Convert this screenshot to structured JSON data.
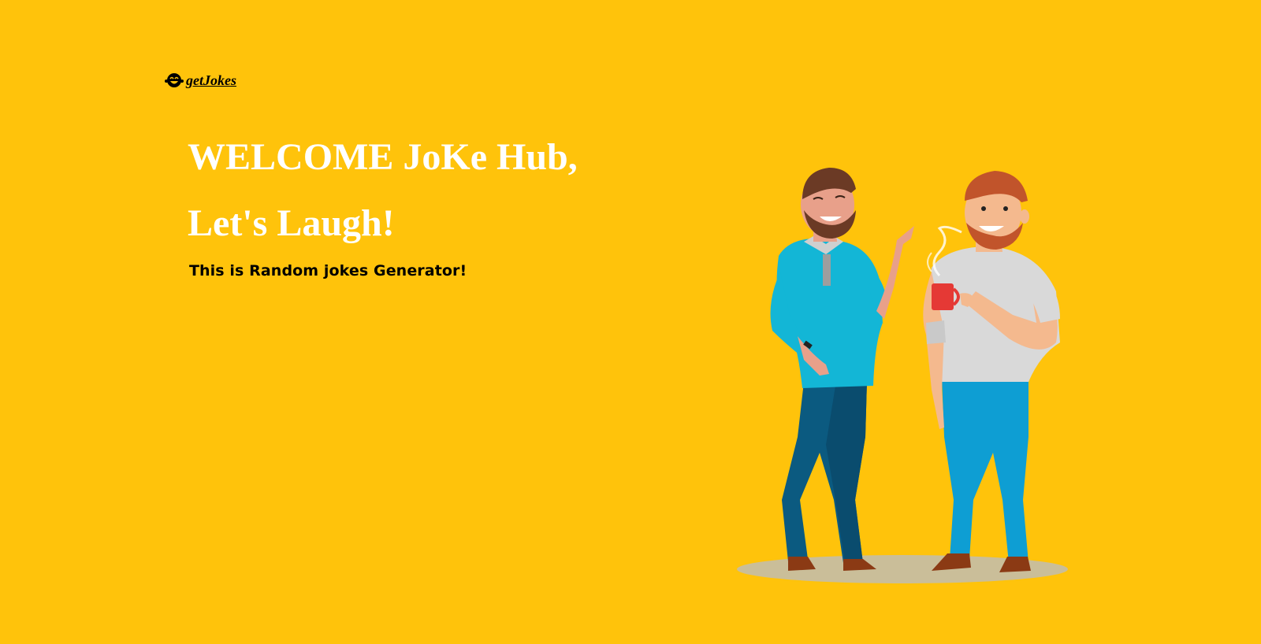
{
  "nav": {
    "brand_icon": "laughing-face-icon",
    "brand_label": "getJokes"
  },
  "hero": {
    "title_line1": "WELCOME JoKe Hub,",
    "title_line2": "Let's Laugh!",
    "subtitle": "This is Random jokes Generator!"
  },
  "illustration": {
    "subject": "two-men-laughing-illustration"
  },
  "colors": {
    "background": "#FFC30B",
    "title": "#FFFFFF",
    "text": "#000000"
  }
}
